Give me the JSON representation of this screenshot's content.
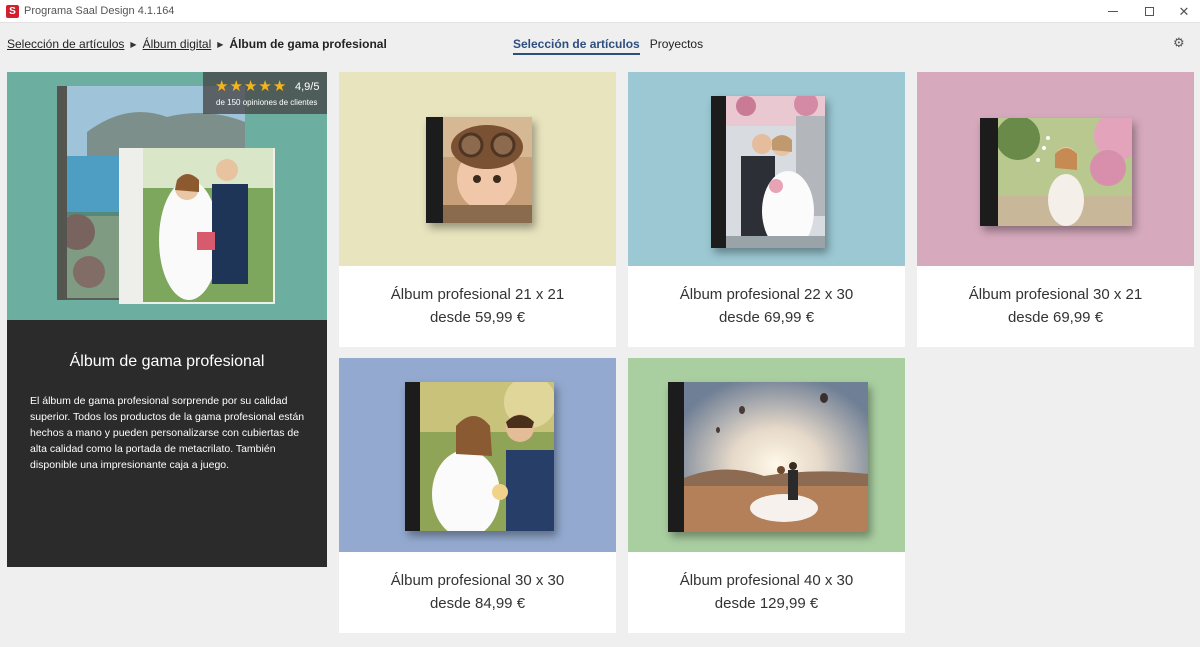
{
  "window": {
    "title": "Programa Saal Design 4.1.164",
    "logo_letter": "S",
    "min_icon": "minimize-icon",
    "max_icon": "maximize-icon",
    "close_glyph": "✕"
  },
  "breadcrumb": {
    "items": [
      "Selección de artículos",
      "Álbum digital"
    ],
    "current": "Álbum de gama profesional",
    "separator": "▶"
  },
  "tabs": [
    {
      "label": "Selección de artículos",
      "active": true
    },
    {
      "label": "Proyectos",
      "active": false
    }
  ],
  "settings_icon": "⚙",
  "info_panel": {
    "rating": {
      "stars": 5,
      "score": "4,9/5",
      "count_text": "de 150 opiniones de clientes",
      "star_glyph": "★"
    },
    "title": "Álbum de gama profesional",
    "description": "El álbum de gama profesional sorprende por su calidad superior. Todos los productos de la gama profesional están hechos a mano y pueden personalizarse con cubiertas de alta calidad como la portada de metacrilato. También disponible una impresionante caja a juego."
  },
  "products": [
    {
      "name": "Álbum profesional 21 x 21",
      "price": "desde 59,99 €",
      "bg": "#e8e4be"
    },
    {
      "name": "Álbum profesional 22 x 30",
      "price": "desde 69,99 €",
      "bg": "#9cc8d3"
    },
    {
      "name": "Álbum profesional 30 x 21",
      "price": "desde 69,99 €",
      "bg": "#d6a9bd"
    },
    {
      "name": "Álbum profesional 30 x 30",
      "price": "desde 84,99 €",
      "bg": "#93a9cf"
    },
    {
      "name": "Álbum profesional 40 x 30",
      "price": "desde 129,99 €",
      "bg": "#a9cfa1"
    }
  ],
  "colors": {
    "accent": "#2d4e7e",
    "panel_bg": "#2b2b2b",
    "star": "#f5b41b",
    "brand": "#d11f2c"
  }
}
